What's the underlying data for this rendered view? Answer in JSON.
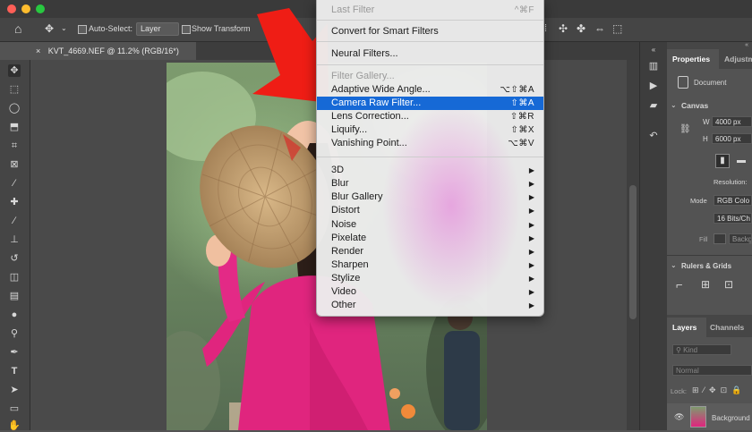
{
  "window": {
    "traffic_lights": [
      "#ff5f57",
      "#febc2e",
      "#28c840"
    ]
  },
  "options_bar": {
    "auto_select_label": "Auto-Select:",
    "auto_select_value": "Layer",
    "show_transform_label": "Show Transform"
  },
  "document_tab": {
    "label": "KVT_4669.NEF @ 11.2% (RGB/16*)"
  },
  "filter_menu": {
    "items": [
      {
        "label": "Last Filter",
        "shortcut": "^⌘F",
        "disabled": true
      },
      {
        "label": "Convert for Smart Filters",
        "shortcut": ""
      },
      {
        "label": "Neural Filters...",
        "shortcut": ""
      },
      {
        "label": "Filter Gallery...",
        "shortcut": "",
        "disabled": true
      },
      {
        "label": "Adaptive Wide Angle...",
        "shortcut": "⌥⇧⌘A"
      },
      {
        "label": "Camera Raw Filter...",
        "shortcut": "⇧⌘A",
        "highlighted": true
      },
      {
        "label": "Lens Correction...",
        "shortcut": "⇧⌘R"
      },
      {
        "label": "Liquify...",
        "shortcut": "⇧⌘X"
      },
      {
        "label": "Vanishing Point...",
        "shortcut": "⌥⌘V"
      },
      {
        "label": "3D",
        "submenu": true
      },
      {
        "label": "Blur",
        "submenu": true
      },
      {
        "label": "Blur Gallery",
        "submenu": true
      },
      {
        "label": "Distort",
        "submenu": true
      },
      {
        "label": "Noise",
        "submenu": true
      },
      {
        "label": "Pixelate",
        "submenu": true
      },
      {
        "label": "Render",
        "submenu": true
      },
      {
        "label": "Sharpen",
        "submenu": true
      },
      {
        "label": "Stylize",
        "submenu": true
      },
      {
        "label": "Video",
        "submenu": true
      },
      {
        "label": "Other",
        "submenu": true
      }
    ],
    "highlight_color": "#1669d6"
  },
  "properties_panel": {
    "tabs": [
      "Properties",
      "Adjustm"
    ],
    "document_label": "Document",
    "canvas_section": "Canvas",
    "w_label": "W",
    "w_value": "4000 px",
    "h_label": "H",
    "h_value": "6000 px",
    "resolution_label": "Resolution:",
    "mode_label": "Mode",
    "mode_value": "RGB Colo",
    "bits_value": "16 Bits/Ch",
    "fill_label": "Fill",
    "background_label": "Backg",
    "rulers_section": "Rulers & Grids"
  },
  "layers_panel": {
    "tabs": [
      "Layers",
      "Channels"
    ],
    "kind_placeholder": "Kind",
    "blend_mode": "Normal",
    "lock_label": "Lock:",
    "layer_name": "Background"
  }
}
